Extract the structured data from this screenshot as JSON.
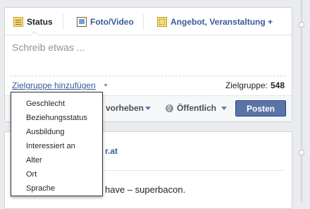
{
  "composer": {
    "tabs": [
      {
        "label": "Status",
        "icon": "status-icon"
      },
      {
        "label": "Foto/Video",
        "icon": "photo-icon"
      },
      {
        "label": "Angebot, Veranstaltung +",
        "icon": "event-icon"
      }
    ],
    "placeholder": "Schreib etwas ...",
    "audience_link": "Zielgruppe hinzufügen",
    "audience_label": "Zielgruppe:",
    "audience_count": "548",
    "highlight_label": "vorheben",
    "privacy_label": "Öffentlich",
    "post_label": "Posten"
  },
  "audience_menu": {
    "items": [
      "Geschlecht",
      "Beziehungsstatus",
      "Ausbildung",
      "Interessiert an",
      "Alter",
      "Ort",
      "Sprache"
    ]
  },
  "feed_post": {
    "link_fragment": "r.at",
    "text_fragment": "have – superbacon."
  },
  "colors": {
    "link": "#3b5998",
    "post_button": "#5b74a8",
    "background": "#e9ebee"
  }
}
